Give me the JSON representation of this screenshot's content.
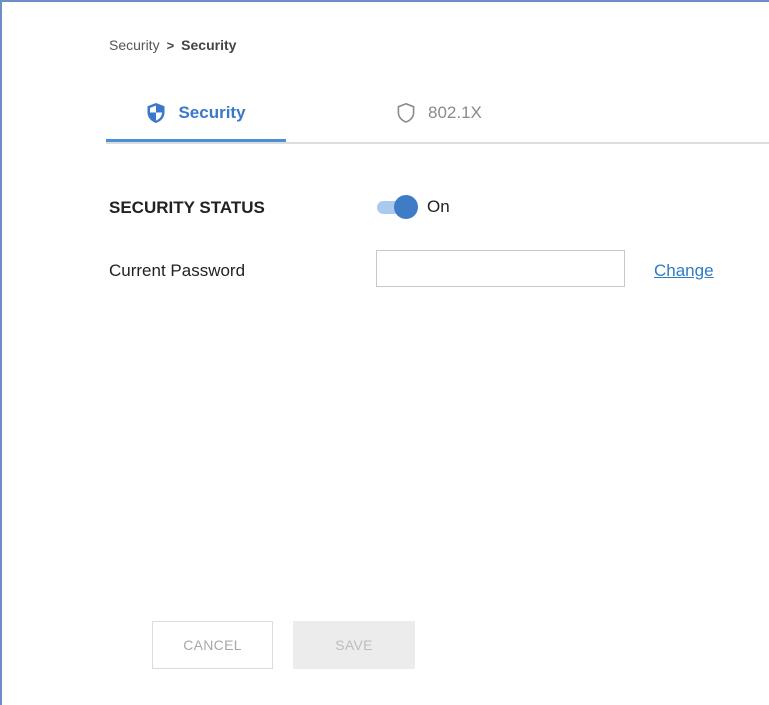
{
  "breadcrumb": {
    "parent": "Security",
    "separator": ">",
    "current": "Security"
  },
  "tabs": [
    {
      "label": "Security",
      "icon": "shield-filled-icon",
      "active": true
    },
    {
      "label": "802.1X",
      "icon": "shield-outline-icon",
      "active": false
    }
  ],
  "security_status": {
    "label": "SECURITY STATUS",
    "toggle_state": "On",
    "enabled": true
  },
  "password": {
    "label": "Current Password",
    "value": "",
    "placeholder": "",
    "change_link": "Change"
  },
  "buttons": {
    "cancel": "CANCEL",
    "save": "SAVE"
  },
  "colors": {
    "accent": "#3a78c9",
    "toggle_track": "#a9c9ee",
    "toggle_knob": "#3f7cc8",
    "frame_border": "#6b8fc4"
  }
}
